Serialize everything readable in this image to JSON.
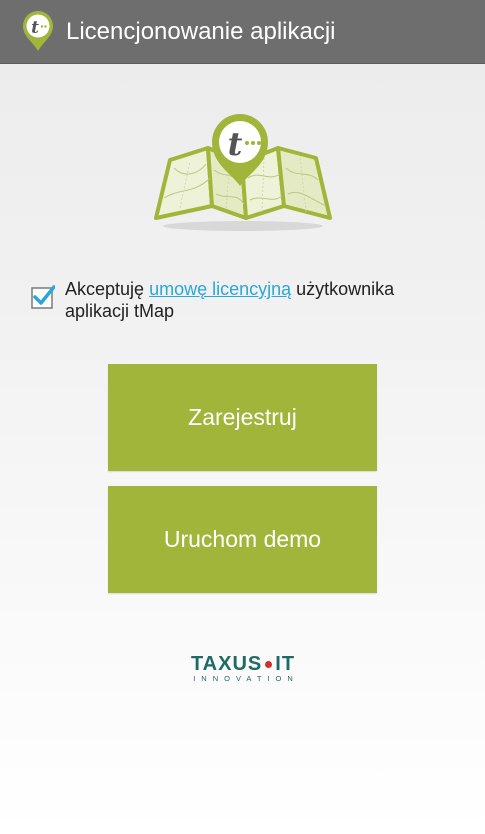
{
  "action_bar": {
    "title": "Licencjonowanie aplikacji",
    "icon": "tmap-pin-icon",
    "background_color": "#6e6e6e"
  },
  "app_logo": {
    "icon": "folded-map-with-pin-icon",
    "pin_letter": "t"
  },
  "license": {
    "checked": true,
    "prefix": "Akceptuję ",
    "link_text": "umowę licencyjną",
    "suffix": " użytkownika aplikacji tMap",
    "link_color": "#2aa7d8",
    "checkbox_color": "#2aa7d8"
  },
  "buttons": {
    "register_label": "Zarejestruj",
    "demo_label": "Uruchom demo",
    "color": "#a1b53a"
  },
  "company": {
    "name_left": "TAXUS",
    "name_right": "IT",
    "tagline": "INNOVATION",
    "color": "#1d6b64",
    "dot_color": "#d82c2c"
  }
}
